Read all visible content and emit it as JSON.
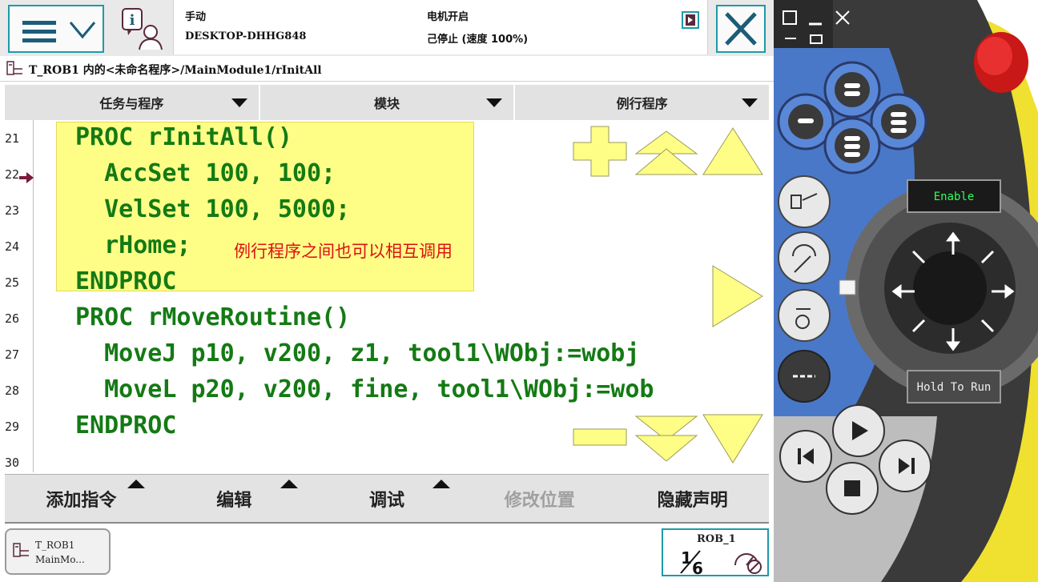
{
  "status": {
    "mode": "手动",
    "hostname": "DESKTOP-DHHG848",
    "motor": "电机开启",
    "state": "己停止 (速度 100%)"
  },
  "path": "T_ROB1 内的<未命名程序>/MainModule1/rInitAll",
  "tabs": [
    {
      "label": "任务与程序"
    },
    {
      "label": "模块"
    },
    {
      "label": "例行程序"
    }
  ],
  "editor": {
    "line_numbers": [
      "21",
      "22",
      "23",
      "24",
      "25",
      "26",
      "27",
      "28",
      "29",
      "30"
    ],
    "lines": [
      "PROC rInitAll()",
      "  AccSet 100, 100;",
      "  VelSet 100, 5000;",
      "  rHome;",
      "ENDPROC",
      "PROC rMoveRoutine()",
      "  MoveJ p10, v200, z1, tool1\\WObj:=wobj",
      "  MoveL p20, v200, fine, tool1\\WObj:=wob",
      "ENDPROC",
      ""
    ],
    "program_pointer_line": "22",
    "annotation": "例行程序之间也可以相互调用"
  },
  "commands": [
    {
      "label": "添加指令",
      "has_menu": true,
      "enabled": true
    },
    {
      "label": "编辑",
      "has_menu": true,
      "enabled": true
    },
    {
      "label": "调试",
      "has_menu": true,
      "enabled": true
    },
    {
      "label": "修改位置",
      "has_menu": false,
      "enabled": false
    },
    {
      "label": "隐藏声明",
      "has_menu": false,
      "enabled": true
    }
  ],
  "taskbar": {
    "task": "T_ROB1",
    "module": "MainMo..."
  },
  "robot": {
    "name": "ROB_1",
    "fraction": "1/6"
  },
  "pendant": {
    "enable_label": "Enable",
    "hold_label": "Hold To Run"
  },
  "colors": {
    "accent": "#1e9aa8",
    "highlight": "#fefe87",
    "code": "#147a14",
    "annotation": "#dd1111",
    "nav_arrow": "#fefe87"
  }
}
